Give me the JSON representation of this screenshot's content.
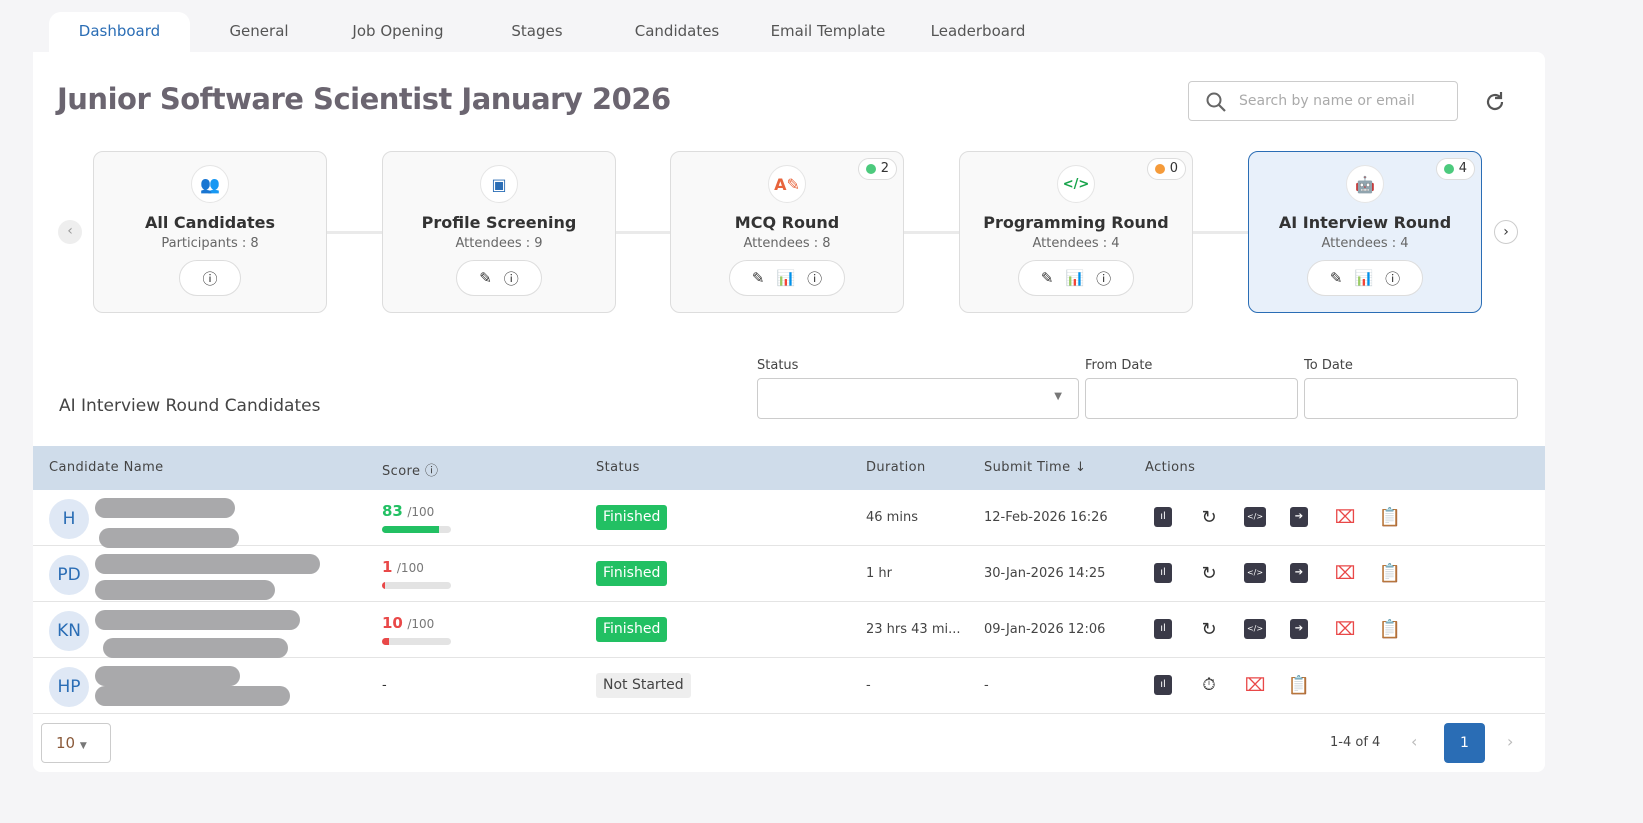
{
  "tabs": [
    "Dashboard",
    "General",
    "Job Opening",
    "Stages",
    "Candidates",
    "Email Template",
    "Leaderboard"
  ],
  "title": "Junior Software Scientist January 2026",
  "search": {
    "placeholder": "Search by name or email"
  },
  "stages": [
    {
      "name": "All Candidates",
      "count": "Participants : 8",
      "badge": null
    },
    {
      "name": "Profile Screening",
      "count": "Attendees : 9",
      "badge": null
    },
    {
      "name": "MCQ Round",
      "count": "Attendees : 8",
      "badge": "2",
      "badge_color": "#4cca7d"
    },
    {
      "name": "Programming Round",
      "count": "Attendees : 4",
      "badge": "0",
      "badge_color": "#f59b3a"
    },
    {
      "name": "AI Interview Round",
      "count": "Attendees : 4",
      "badge": "4",
      "badge_color": "#4cca7d"
    }
  ],
  "filters": {
    "section_title": "AI Interview Round Candidates",
    "status_label": "Status",
    "from_label": "From Date",
    "to_label": "To Date"
  },
  "table": {
    "headers": [
      "Candidate Name",
      "Score",
      "Status",
      "Duration",
      "Submit Time",
      "Actions"
    ],
    "rows": [
      {
        "initials": "H",
        "score": "83",
        "max": "/100",
        "pct": 83,
        "score_color": "#22c063",
        "status": "Finished",
        "duration": "46 mins",
        "submit": "12-Feb-2026 16:26"
      },
      {
        "initials": "PD",
        "score": "1",
        "max": "/100",
        "pct": 1,
        "score_color": "#e94848",
        "status": "Finished",
        "duration": "1 hr",
        "submit": "30-Jan-2026 14:25"
      },
      {
        "initials": "KN",
        "score": "10",
        "max": "/100",
        "pct": 10,
        "score_color": "#e94848",
        "status": "Finished",
        "duration": "23 hrs 43 mi...",
        "submit": "09-Jan-2026 12:06"
      },
      {
        "initials": "HP",
        "score": "-",
        "status": "Not Started",
        "duration": "-",
        "submit": "-"
      }
    ]
  },
  "footer": {
    "page_size": "10",
    "range": "1-4 of 4",
    "page": "1"
  },
  "colors": {
    "accent": "#2a6db5",
    "finished": "#22c063",
    "header": "#cfdcea"
  }
}
